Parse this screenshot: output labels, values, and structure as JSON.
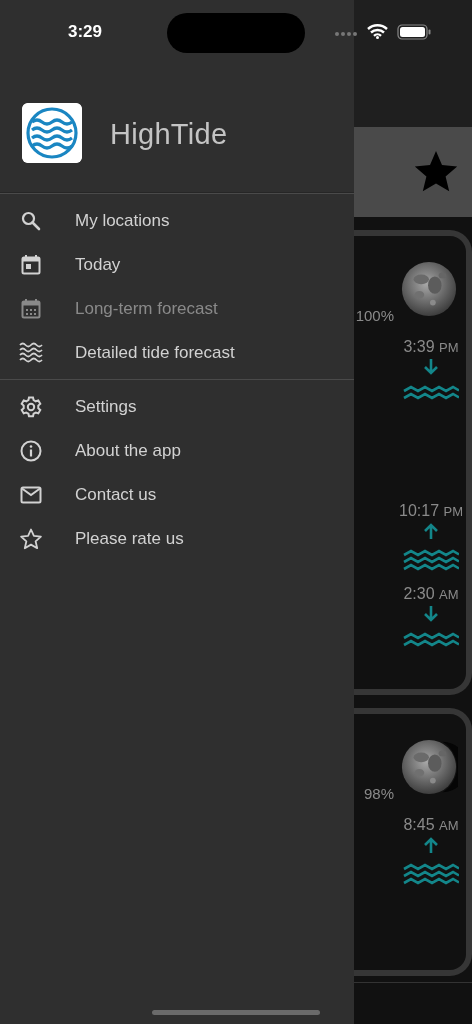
{
  "status_bar": {
    "time": "3:29"
  },
  "drawer": {
    "app_name": "HighTide",
    "sections": [
      [
        {
          "label": "My locations",
          "kind": "search",
          "disabled": false
        },
        {
          "label": "Today",
          "kind": "today",
          "disabled": false
        },
        {
          "label": "Long-term forecast",
          "kind": "calendar",
          "disabled": true
        },
        {
          "label": "Detailed tide forecast",
          "kind": "waves",
          "disabled": false
        }
      ],
      [
        {
          "label": "Settings",
          "kind": "settings",
          "disabled": false
        },
        {
          "label": "About the app",
          "kind": "info",
          "disabled": false
        },
        {
          "label": "Contact us",
          "kind": "mail",
          "disabled": false
        },
        {
          "label": "Please rate us",
          "kind": "star",
          "disabled": false
        }
      ]
    ]
  },
  "background": {
    "cards": [
      {
        "moon": {
          "kind": "full",
          "illumination": "100%"
        },
        "tides": [
          {
            "time": "3:39",
            "period": "PM",
            "kind": "falling"
          },
          {
            "time": "10:17",
            "period": "PM",
            "kind": "rising"
          },
          {
            "time": "2:30",
            "period": "AM",
            "kind": "falling"
          }
        ]
      },
      {
        "moon": {
          "kind": "gibbous",
          "illumination": "98%"
        },
        "tides": [
          {
            "time": "8:45",
            "period": "AM",
            "kind": "rising"
          }
        ]
      }
    ]
  }
}
